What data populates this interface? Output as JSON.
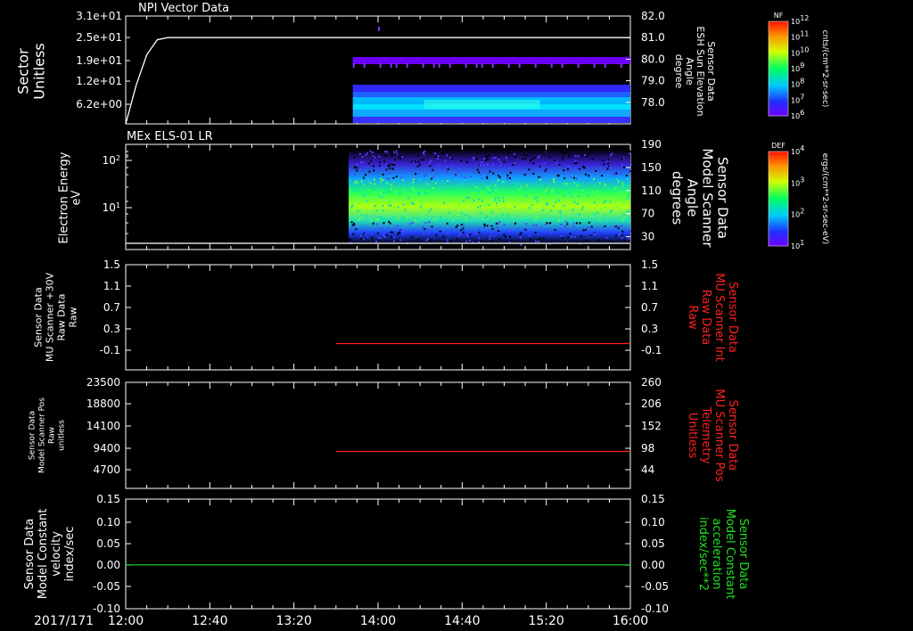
{
  "colors": {
    "background": "#000000",
    "frame": "#ffffff",
    "red_trace": "#ff2020",
    "green_trace": "#20e020",
    "white_trace": "#ffffff"
  },
  "time_axis": {
    "date": "2017/171",
    "ticks": [
      "12:00",
      "12:40",
      "13:20",
      "14:00",
      "14:40",
      "15:20",
      "16:00"
    ],
    "range": [
      "12:00",
      "16:00"
    ]
  },
  "chart_data": [
    {
      "type": "heatmap",
      "title": "NPI Vector Data",
      "ylabel_left": [
        "Sector",
        "Unitless"
      ],
      "yticks_left": [
        "3.1e+01",
        "2.5e+01",
        "1.9e+01",
        "1.2e+01",
        "6.2e+00"
      ],
      "ylim_left": [
        0,
        31
      ],
      "ylabel_right": [
        "Sensor Data",
        "ESH Sun Elevation",
        "Angle",
        "degree"
      ],
      "yticks_right": [
        "82.0",
        "81.0",
        "80.0",
        "79.0",
        "78.0"
      ],
      "ylim_right": [
        77.0,
        82.0
      ],
      "line_series": {
        "x": [
          "12:00",
          "12:05",
          "12:10",
          "12:15",
          "12:20",
          "16:00"
        ],
        "y": [
          77.0,
          78.8,
          80.2,
          80.9,
          81.0,
          81.0
        ]
      },
      "data_start": "13:48",
      "colorbar": {
        "label": "NF",
        "units": "cnts/(cm**2-sr-sec)",
        "ticks": [
          "10^12",
          "10^11",
          "10^10",
          "10^9",
          "10^8",
          "10^7",
          "10^6"
        ]
      }
    },
    {
      "type": "heatmap",
      "title": "MEx ELS-01 LR",
      "ylabel_left": [
        "Electron Energy",
        "eV"
      ],
      "yticks_left": [
        "10^2",
        "10^1"
      ],
      "yscale_left": "log",
      "ylabel_right": [
        "Sensor Data",
        "Model Scanner",
        "Angle",
        "degrees"
      ],
      "yticks_right": [
        "190",
        "150",
        "110",
        "70",
        "30"
      ],
      "ylim_right": [
        0,
        190
      ],
      "line_series": {
        "x": [
          "12:00",
          "16:00"
        ],
        "y": [
          4,
          4
        ]
      },
      "data_start": "13:46",
      "colorbar": {
        "label": "DEF",
        "units": "ergs/(cm**2-sr-sec-eV)",
        "ticks": [
          "10^4",
          "10^3",
          "10^2",
          "10^1"
        ]
      }
    },
    {
      "type": "line",
      "ylabel_left": [
        "Sensor Data",
        "MU Scanner +30V",
        "Raw Data",
        "Raw"
      ],
      "yticks_left": [
        "1.5",
        "1.1",
        "0.7",
        "0.3",
        "-0.1"
      ],
      "ylim_left": [
        -0.5,
        1.5
      ],
      "ylabel_right": [
        "Sensor Data",
        "MU Scanner Int",
        "Raw Data",
        "Raw"
      ],
      "yticks_right": [
        "1.5",
        "1.1",
        "0.7",
        "0.3",
        "-0.1"
      ],
      "series": [
        {
          "x": [
            "13:40",
            "16:00"
          ],
          "y": [
            0.0,
            0.0
          ]
        }
      ]
    },
    {
      "type": "line",
      "ylabel_left": [
        "Sensor Data",
        "Model Scanner Pos",
        "Raw",
        "unitless"
      ],
      "yticks_left": [
        "23500",
        "18800",
        "14100",
        "9400",
        "4700"
      ],
      "ylim_left": [
        0,
        23500
      ],
      "ylabel_right": [
        "Sensor Data",
        "MU Scanner Pos",
        "Telemetry",
        "Unitless"
      ],
      "yticks_right": [
        "260",
        "206",
        "152",
        "98",
        "44"
      ],
      "ylim_right": [
        -10,
        260
      ],
      "series": [
        {
          "x": [
            "13:40",
            "16:00"
          ],
          "y": [
            8200,
            8200
          ]
        }
      ]
    },
    {
      "type": "line",
      "ylabel_left": [
        "Sensor Data",
        "Model Constant",
        "velocity",
        "index/sec"
      ],
      "yticks_left": [
        "0.15",
        "0.10",
        "0.05",
        "0.00",
        "-0.05",
        "-0.10"
      ],
      "ylim_left": [
        -0.1,
        0.15
      ],
      "ylabel_right": [
        "Sensor Data",
        "Model Constant",
        "acceleration",
        "index/sec**2"
      ],
      "yticks_right": [
        "0.15",
        "0.10",
        "0.05",
        "0.00",
        "-0.05",
        "-0.10"
      ],
      "series": [
        {
          "x": [
            "12:00",
            "16:00"
          ],
          "y": [
            0.0,
            0.0
          ]
        }
      ]
    }
  ]
}
